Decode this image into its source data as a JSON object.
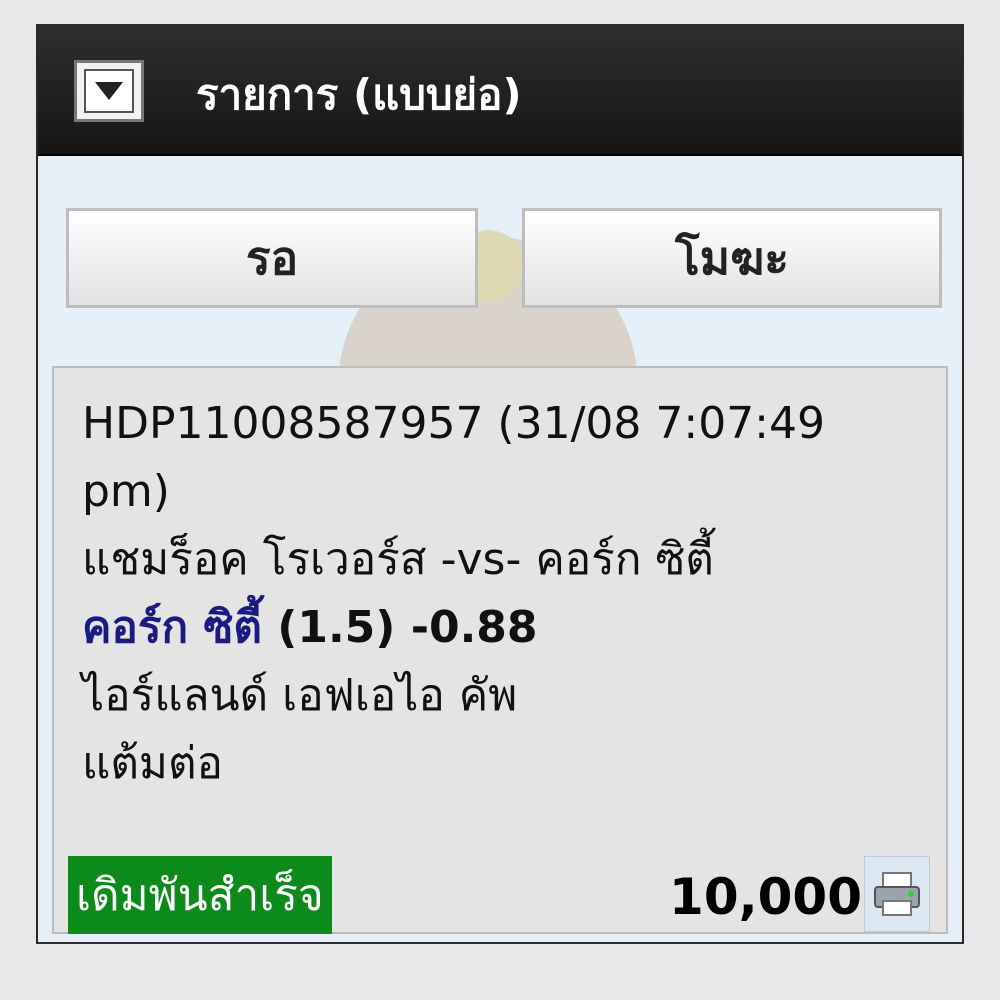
{
  "header": {
    "title": "รายการ (แบบย่อ)",
    "collapse_icon": "chevron-down-icon"
  },
  "tabs": [
    {
      "label": "รอ"
    },
    {
      "label": "โมฆะ"
    }
  ],
  "ticket": {
    "ref": "HDP11008587957 (31/08 7:07:49 pm)",
    "match": "แชมร็อค โรเวอร์ส -vs- คอร์ก ซิตี้",
    "pick_team": "คอร์ก ซิตี้",
    "pick_odds": "(1.5)  -0.88",
    "league": "ไอร์แลนด์ เอฟเอไอ คัพ",
    "bet_type": "แต้มต่อ",
    "status": "เดิมพันสำเร็จ",
    "amount": "10,000",
    "status_color": "#0c8a1a",
    "print_icon": "printer-icon"
  }
}
